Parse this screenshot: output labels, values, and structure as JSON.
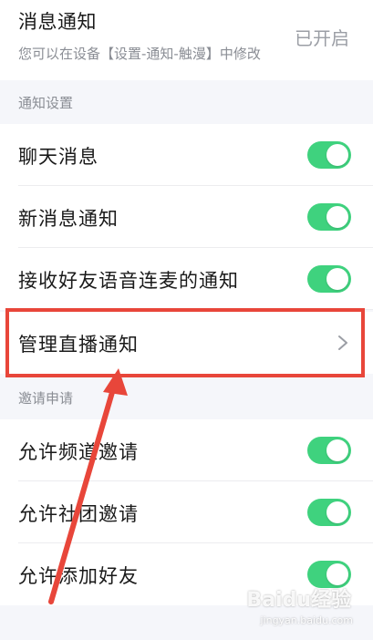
{
  "header": {
    "title": "消息通知",
    "subtitle": "您可以在设备【设置-通知-触漫】中修改",
    "status": "已开启"
  },
  "sections": [
    {
      "header": "通知设置",
      "items": [
        {
          "label": "聊天消息",
          "control": "toggle",
          "on": true
        },
        {
          "label": "新消息通知",
          "control": "toggle",
          "on": true
        },
        {
          "label": "接收好友语音连麦的通知",
          "control": "toggle",
          "on": true
        },
        {
          "label": "管理直播通知",
          "control": "chevron"
        }
      ]
    },
    {
      "header": "邀请申请",
      "items": [
        {
          "label": "允许频道邀请",
          "control": "toggle",
          "on": true
        },
        {
          "label": "允许社团邀请",
          "control": "toggle",
          "on": true
        },
        {
          "label": "允许添加好友",
          "control": "toggle",
          "on": true
        }
      ]
    }
  ],
  "colors": {
    "toggle_on": "#3fd27e",
    "highlight": "#e8463a",
    "background": "#f5f6fa"
  },
  "watermark": {
    "brand": "Baidu经验",
    "url": "jingyan.baidu.com"
  }
}
